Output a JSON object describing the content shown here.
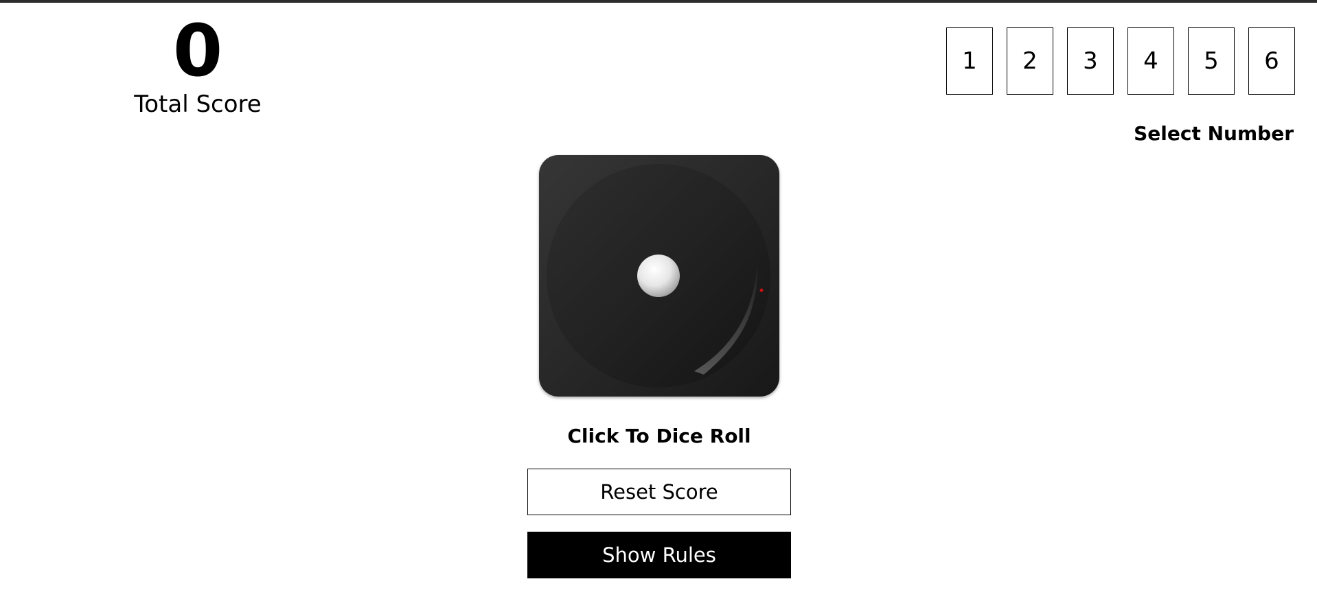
{
  "score": {
    "value": "0",
    "label": "Total Score"
  },
  "selector": {
    "numbers": [
      "1",
      "2",
      "3",
      "4",
      "5",
      "6"
    ],
    "label": "Select Number"
  },
  "dice": {
    "face": 1,
    "roll_label": "Click To Dice Roll"
  },
  "buttons": {
    "reset_label": "Reset Score",
    "rules_label": "Show Rules"
  },
  "colors": {
    "dice_body": "#262626",
    "pip": "#ffffff",
    "rules_button_bg": "#000000"
  }
}
